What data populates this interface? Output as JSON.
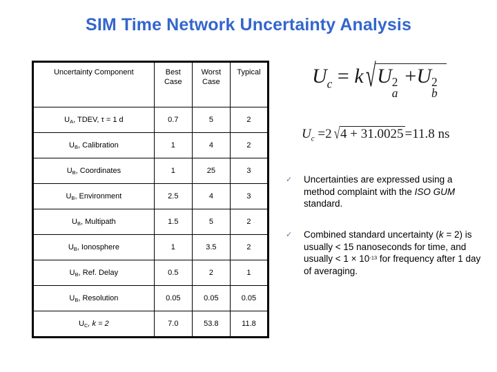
{
  "title": "SIM Time Network Uncertainty Analysis",
  "title_color": "#3366cc",
  "table": {
    "headers": {
      "component": "Uncertainty Component",
      "best_case": "Best\nCase",
      "worst_case": "Worst\nCase",
      "typical": "Typical"
    },
    "rows": [
      {
        "symbol": "U",
        "subscript": "A",
        "label": ", TDEV, τ = 1 d",
        "best_case": "0.7",
        "worst_case": "5",
        "typical": "2"
      },
      {
        "symbol": "U",
        "subscript": "B",
        "label": ", Calibration",
        "best_case": "1",
        "worst_case": "4",
        "typical": "2"
      },
      {
        "symbol": "U",
        "subscript": "B",
        "label": ", Coordinates",
        "best_case": "1",
        "worst_case": "25",
        "typical": "3"
      },
      {
        "symbol": "U",
        "subscript": "B",
        "label": ", Environment",
        "best_case": "2.5",
        "worst_case": "4",
        "typical": "3"
      },
      {
        "symbol": "U",
        "subscript": "B",
        "label": ", Multipath",
        "best_case": "1.5",
        "worst_case": "5",
        "typical": "2"
      },
      {
        "symbol": "U",
        "subscript": "B",
        "label": ", Ionosphere",
        "best_case": "1",
        "worst_case": "3.5",
        "typical": "2"
      },
      {
        "symbol": "U",
        "subscript": "B",
        "label": ", Ref. Delay",
        "best_case": "0.5",
        "worst_case": "2",
        "typical": "1"
      },
      {
        "symbol": "U",
        "subscript": "B",
        "label": ", Resolution",
        "best_case": "0.05",
        "worst_case": "0.05",
        "typical": "0.05"
      },
      {
        "symbol": "U",
        "subscript": "C",
        "label": ", k = 2",
        "label_italic_part": "k",
        "best_case": "7.0",
        "worst_case": "53.8",
        "typical": "11.8"
      }
    ]
  },
  "formulas": {
    "combined": {
      "plain": "U_c = k √(U_a² + U_b²)",
      "lhs_var": "U",
      "lhs_sub": "c",
      "equals": "=",
      "coefficient": "k",
      "term_a_var": "U",
      "term_a_sub": "a",
      "term_a_sup": "2",
      "plus": "+",
      "term_b_var": "U",
      "term_b_sub": "b",
      "term_b_sup": "2"
    },
    "example": {
      "plain": "U_c = 2 √(4 + 31.0025) = 11.8 ns",
      "lhs_var": "U",
      "lhs_sub": "c",
      "equals1": "=",
      "coefficient": "2",
      "radicand": "4 + 31.0025",
      "equals2": "=",
      "result": "11.8",
      "unit": "ns"
    }
  },
  "bullets": [
    {
      "marker": "✓",
      "marker_color": "#5a77a8",
      "text_pre": "Uncertainties are expressed using a method complaint with the ",
      "text_italic": "ISO GUM",
      "text_post": " standard."
    },
    {
      "marker": "✓",
      "marker_color": "#5a77a8",
      "text_pre": "Combined standard uncertainty (",
      "text_italic": "k",
      "text_mid": " = 2)  is usually < 15 nanoseconds for time, and  usually < 1 × 10",
      "text_sup": "-13",
      "text_post": " for frequency after 1 day of averaging."
    }
  ]
}
